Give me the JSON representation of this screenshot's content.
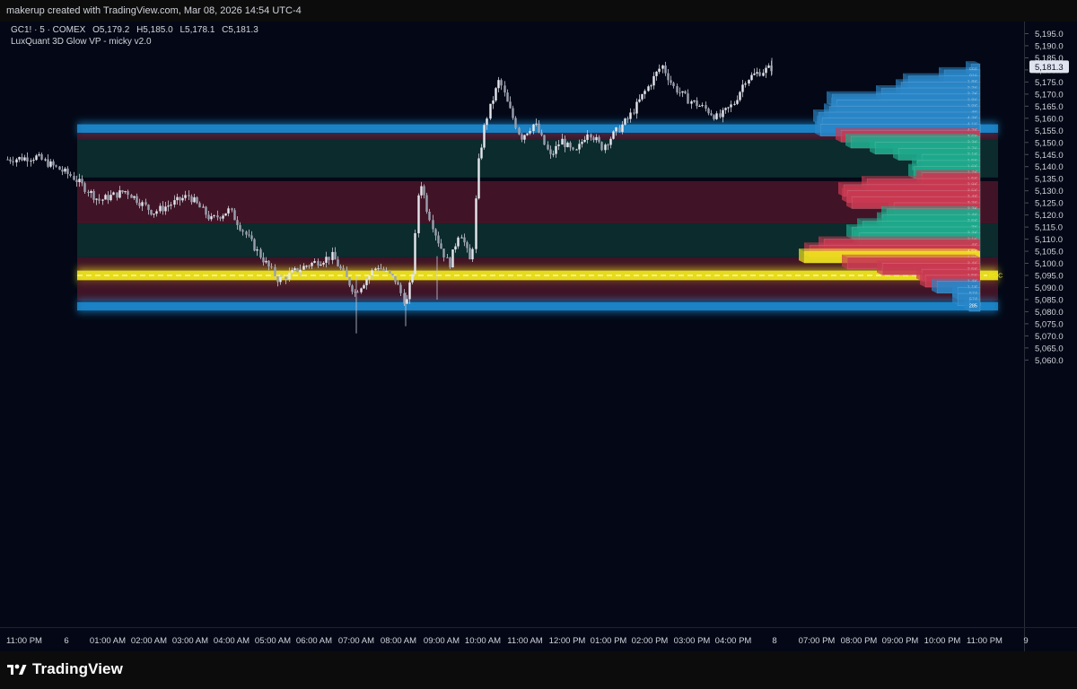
{
  "top_caption": "makerup created with TradingView.com, Mar 08, 2026 14:54 UTC-4",
  "legend": {
    "symbol": "GC1! · 5 · COMEX",
    "open": "O5,179.2",
    "high": "H5,185.0",
    "low": "L5,178.1",
    "close": "C5,181.3",
    "indicator": "LuxQuant 3D Glow VP - micky v2.0"
  },
  "brand": "TradingView",
  "colors": {
    "background": "#040816",
    "blue_zone": "#1e90d8",
    "red_zone": "#5a1a2e",
    "green_zone": "#0f3a36",
    "poc": "#f2e61d",
    "candle": "#c8cad4",
    "vp_blue": "#2a86c8",
    "vp_red": "#c93a52",
    "vp_green": "#1fa98c",
    "price_tag_bg": "#dfe3f0"
  },
  "price_axis": {
    "labels": [
      "5,195.0",
      "5,190.0",
      "5,185.0",
      "5,180.0",
      "5,175.0",
      "5,170.0",
      "5,165.0",
      "5,160.0",
      "5,155.0",
      "5,150.0",
      "5,145.0",
      "5,140.0",
      "5,135.0",
      "5,130.0",
      "5,125.0",
      "5,120.0",
      "5,115.0",
      "5,110.0",
      "5,105.0",
      "5,100.0",
      "5,095.0",
      "5,090.0",
      "5,085.0",
      "5,080.0",
      "5,075.0",
      "5,070.0",
      "5,065.0",
      "5,060.0"
    ],
    "current_price": "5,181.3"
  },
  "time_axis": {
    "labels": [
      "11:00 PM",
      "6",
      "01:00 AM",
      "02:00 AM",
      "03:00 AM",
      "04:00 AM",
      "05:00 AM",
      "06:00 AM",
      "07:00 AM",
      "08:00 AM",
      "09:00 AM",
      "10:00 AM",
      "11:00 AM",
      "12:00 PM",
      "01:00 PM",
      "02:00 PM",
      "03:00 PM",
      "04:00 PM",
      "8",
      "07:00 PM",
      "08:00 PM",
      "09:00 PM",
      "10:00 PM",
      "11:00 PM",
      "9"
    ]
  },
  "zones": [
    {
      "kind": "blue",
      "from": 5154,
      "to": 5157.5
    },
    {
      "kind": "red",
      "from": 5151,
      "to": 5154
    },
    {
      "kind": "green",
      "from": 5135.5,
      "to": 5151
    },
    {
      "kind": "red",
      "from": 5116.5,
      "to": 5134
    },
    {
      "kind": "green",
      "from": 5102.5,
      "to": 5116.5
    },
    {
      "kind": "red",
      "from": 5097,
      "to": 5102.5
    },
    {
      "kind": "poc",
      "from": 5093,
      "to": 5097
    },
    {
      "kind": "red",
      "from": 5084.5,
      "to": 5093
    },
    {
      "kind": "blue",
      "from": 5080.5,
      "to": 5084
    }
  ],
  "zone_labels": {
    "poc": "POC"
  },
  "volume_profile": [
    {
      "price": 5182.5,
      "label": "556",
      "color": "blue",
      "width": 10
    },
    {
      "price": 5180,
      "label": "916",
      "color": "blue",
      "width": 40
    },
    {
      "price": 5177.5,
      "label": "1.8K",
      "color": "blue",
      "width": 80
    },
    {
      "price": 5175,
      "label": "2.2K",
      "color": "blue",
      "width": 88
    },
    {
      "price": 5172.5,
      "label": "2.7K",
      "color": "blue",
      "width": 110
    },
    {
      "price": 5170,
      "label": "3.8K",
      "color": "blue",
      "width": 165
    },
    {
      "price": 5167.5,
      "label": "3.9K",
      "color": "blue",
      "width": 160
    },
    {
      "price": 5165,
      "label": "4K",
      "color": "blue",
      "width": 168
    },
    {
      "price": 5162.5,
      "label": "4.3K",
      "color": "blue",
      "width": 180
    },
    {
      "price": 5160,
      "label": "4.1K",
      "color": "blue",
      "width": 176
    },
    {
      "price": 5157.5,
      "label": "4.2K",
      "color": "blue",
      "width": 178
    },
    {
      "price": 5155,
      "label": "3.6K",
      "color": "red",
      "width": 155
    },
    {
      "price": 5152.5,
      "label": "3.3K",
      "color": "green",
      "width": 144
    },
    {
      "price": 5150,
      "label": "2.7K",
      "color": "green",
      "width": 117
    },
    {
      "price": 5147.5,
      "label": "2.1K",
      "color": "green",
      "width": 91
    },
    {
      "price": 5145,
      "label": "1.5K",
      "color": "green",
      "width": 65
    },
    {
      "price": 5142.5,
      "label": "1.6K",
      "color": "green",
      "width": 70
    },
    {
      "price": 5140,
      "label": "1.7K",
      "color": "green",
      "width": 74
    },
    {
      "price": 5137.5,
      "label": "1.5K",
      "color": "red",
      "width": 65
    },
    {
      "price": 5135,
      "label": "2.9K",
      "color": "red",
      "width": 126
    },
    {
      "price": 5132.5,
      "label": "3.5K",
      "color": "red",
      "width": 152
    },
    {
      "price": 5130,
      "label": "3.4K",
      "color": "red",
      "width": 148
    },
    {
      "price": 5127.5,
      "label": "3.3K",
      "color": "red",
      "width": 143
    },
    {
      "price": 5125,
      "label": "2.2K",
      "color": "red",
      "width": 96
    },
    {
      "price": 5122.5,
      "label": "2.4K",
      "color": "green",
      "width": 104
    },
    {
      "price": 5120,
      "label": "2.5K",
      "color": "green",
      "width": 109
    },
    {
      "price": 5117.5,
      "label": "3K",
      "color": "green",
      "width": 131
    },
    {
      "price": 5115,
      "label": "3.3K",
      "color": "green",
      "width": 143
    },
    {
      "price": 5112.5,
      "label": "3.1K",
      "color": "green",
      "width": 135
    },
    {
      "price": 5110,
      "label": "4K",
      "color": "red",
      "width": 174
    },
    {
      "price": 5107.5,
      "label": "4.5K",
      "color": "red",
      "width": 190
    },
    {
      "price": 5105,
      "label": "4.8K",
      "color": "poc",
      "width": 196
    },
    {
      "price": 5102.5,
      "label": "3.4K",
      "color": "red",
      "width": 148
    },
    {
      "price": 5100,
      "label": "2.5K",
      "color": "red",
      "width": 109
    },
    {
      "price": 5097.5,
      "label": "1.5K",
      "color": "red",
      "width": 65
    },
    {
      "price": 5095,
      "label": "1.4K",
      "color": "red",
      "width": 61
    },
    {
      "price": 5092.5,
      "label": "1.1K",
      "color": "blue",
      "width": 48
    },
    {
      "price": 5090,
      "label": "574",
      "color": "blue",
      "width": 25
    },
    {
      "price": 5087.5,
      "label": "574",
      "color": "blue",
      "width": 25
    },
    {
      "price": 5085,
      "label": "285",
      "color": "blue",
      "width": 12
    }
  ]
}
